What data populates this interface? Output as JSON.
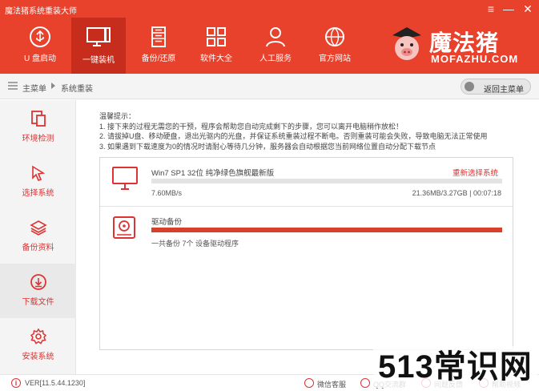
{
  "app": {
    "title": "魔法猪系统重装大师"
  },
  "window_controls": {
    "menu": "≡",
    "minimize": "—",
    "close": "✕"
  },
  "nav": [
    {
      "label": "U 盘启动",
      "icon": "usb-icon"
    },
    {
      "label": "一键装机",
      "icon": "monitor-icon",
      "active": true
    },
    {
      "label": "备份/还原",
      "icon": "backup-icon"
    },
    {
      "label": "软件大全",
      "icon": "apps-grid-icon"
    },
    {
      "label": "人工服务",
      "icon": "person-icon"
    },
    {
      "label": "官方网站",
      "icon": "globe-icon"
    }
  ],
  "logo": {
    "text": "魔法猪",
    "subtext": "MOFAZHU.COM"
  },
  "breadcrumb": {
    "home": "主菜单",
    "current": "系统重装"
  },
  "back_button": "返回主菜单",
  "sidebar": [
    {
      "label": "环境检测",
      "icon": "device-check-icon"
    },
    {
      "label": "选择系统",
      "icon": "cursor-icon"
    },
    {
      "label": "备份资料",
      "icon": "layers-icon"
    },
    {
      "label": "下载文件",
      "icon": "download-icon",
      "active": true
    },
    {
      "label": "安装系统",
      "icon": "gear-icon"
    }
  ],
  "tips": {
    "title": "温馨提示：",
    "lines": [
      "1. 接下来的过程无需您的干预，程序会帮助您自动完成剩下的步骤，您可以离开电脑稍作放松！",
      "2. 请拔掉U盘、移动硬盘，退出光驱内的光盘，并保证系统重装过程不断电。否则重装可能会失败，导致电脑无法正常使用",
      "3. 如果遇到下载速度为0的情况时请耐心等待几分钟，服务器会自动根据您当前网络位置自动分配下载节点"
    ]
  },
  "tasks": [
    {
      "icon": "monitor-icon",
      "name": "Win7 SP1 32位 纯净绿色旗舰最新版",
      "action": "重新选择系统",
      "progress": 0.0,
      "speed": "7.60MB/s",
      "status": "21.36MB/3.27GB | 00:07:18"
    },
    {
      "icon": "driver-icon",
      "name": "驱动备份",
      "progress": 1.0,
      "detail": "一共备份 7个 设备驱动程序"
    }
  ],
  "footer": {
    "version": "VER[11.5.44.1230]",
    "links": [
      {
        "label": "微信客服",
        "icon": "wechat-icon"
      },
      {
        "label": "QQ交流群",
        "icon": "qq-icon"
      },
      {
        "label": "问题反馈",
        "icon": "feedback-icon"
      },
      {
        "label": "帮助视频",
        "icon": "video-icon"
      }
    ]
  },
  "watermark": "513常识网",
  "colors": {
    "brand": "#e8412c",
    "brand_dark": "#c72d1d",
    "accent_text": "#dd3333",
    "progress": "#d5412c"
  }
}
